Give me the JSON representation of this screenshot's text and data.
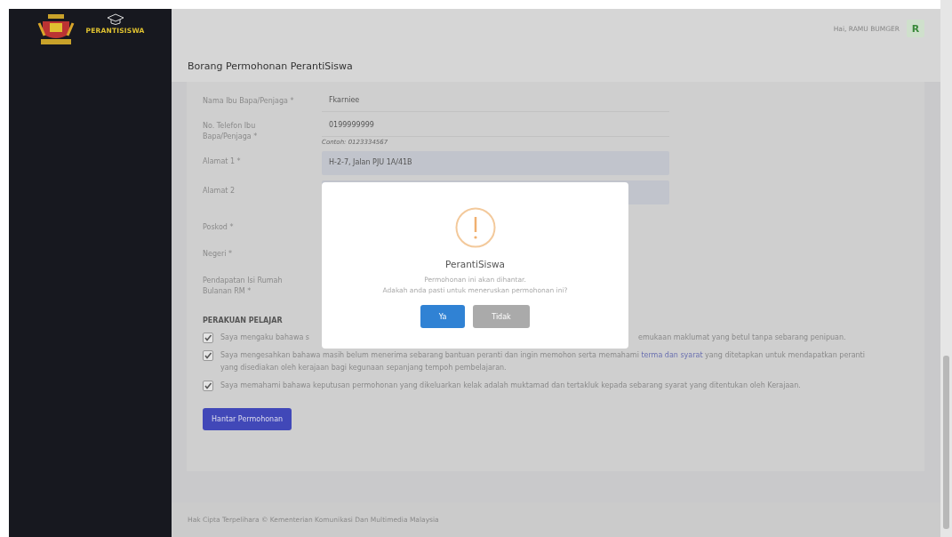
{
  "sidebar": {
    "brand_text": "PERANTISISWA"
  },
  "header": {
    "greeting": "Hai, RAMU BUMGER",
    "avatar_initial": "R",
    "page_title": "Borang Permohonan PerantiSiswa"
  },
  "form": {
    "fields": [
      {
        "label": "Nama Ibu Bapa/Penjaga *",
        "kind": "text",
        "value": "Fkarniee"
      },
      {
        "label": "No. Telefon Ibu Bapa/Penjaga *",
        "kind": "text",
        "value": "0199999999",
        "hint": "Contoh: 0123334567"
      },
      {
        "label": "Alamat 1 *",
        "kind": "filled",
        "value": "H-2-7, Jalan PJU 1A/41B"
      },
      {
        "label": "Alamat 2",
        "kind": "filled"
      },
      {
        "label": "Poskod *",
        "kind": "hidden"
      },
      {
        "label": "Negeri *",
        "kind": "hidden"
      },
      {
        "label": "Pendapatan Isi Rumah Bulanan RM *",
        "kind": "hidden"
      }
    ],
    "section_title": "PERAKUAN PELAJAR",
    "declarations": [
      {
        "checked": true,
        "text": "Saya mengaku bahawa s",
        "text_end": "emukaan maklumat yang betul tanpa sebarang penipuan."
      },
      {
        "checked": true,
        "text": "Saya mengesahkan bahawa masih belum menerima sebarang bantuan peranti dan ingin memohon serta memahami ",
        "link": "terma dan syarat",
        "text_after": " yang ditetapkan untuk mendapatkan peranti yang disediakan oleh kerajaan bagi kegunaan sepanjang tempoh pembelajaran."
      },
      {
        "checked": true,
        "text": "Saya memahami bahawa keputusan permohonan yang dikeluarkan kelak adalah muktamad dan tertakluk kepada sebarang syarat yang ditentukan oleh Kerajaan."
      }
    ],
    "submit": "Hantar Permohonan"
  },
  "modal": {
    "title": "PerantiSiswa",
    "message_lines": [
      "Permohonan ini akan dihantar.",
      "Adakah anda pasti untuk meneruskan permohonan ini?"
    ],
    "buttons": [
      {
        "label": "Ya",
        "kind": "confirm"
      },
      {
        "label": "Tidak",
        "kind": "cancel"
      }
    ]
  },
  "footer": "Hak Cipta Terpelihara © Kementerian Komunikasi Dan Multimedia Malaysia"
}
